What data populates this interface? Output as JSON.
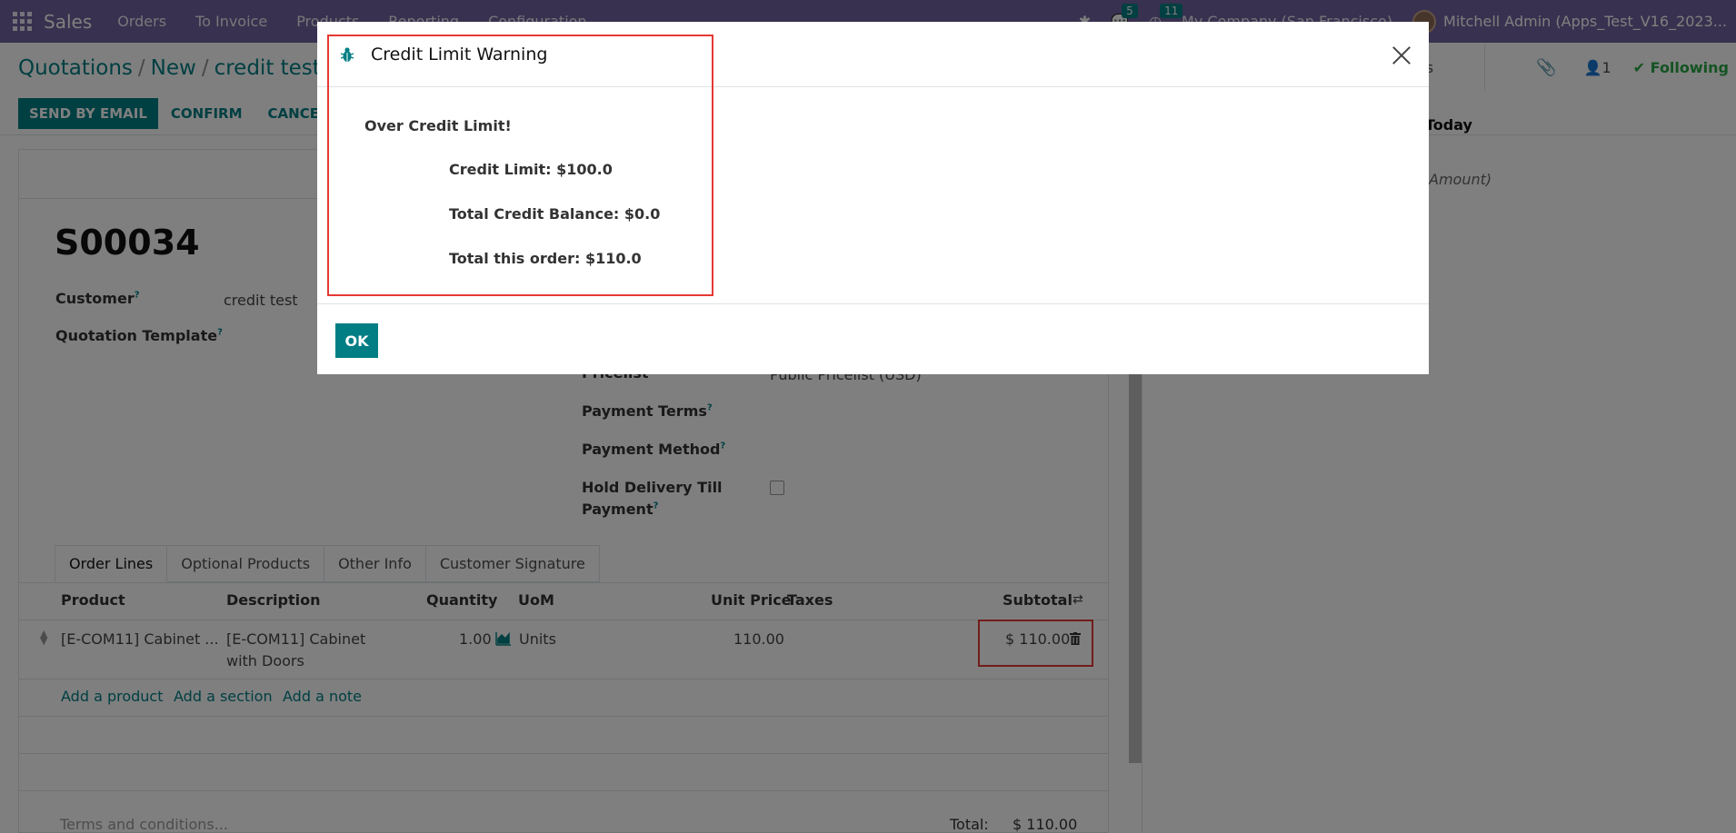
{
  "navbar": {
    "brand": "Sales",
    "menu": [
      "Orders",
      "To Invoice",
      "Products",
      "Reporting",
      "Configuration"
    ],
    "messages_count": "5",
    "activities_count": "11",
    "company": "My Company (San Francisco)",
    "user": "Mitchell Admin (Apps_Test_V16_2023..."
  },
  "breadcrumb": {
    "first": "Quotations",
    "second": "New",
    "third": "credit test",
    "sep": "/"
  },
  "actions": {
    "send_by_email": "SEND BY EMAIL",
    "confirm": "CONFIRM",
    "cancel": "CANCEL"
  },
  "chatter": {
    "activities": "tivities",
    "followers_count": "1",
    "following": "Following",
    "today": "Today",
    "amount_fragment": "Amount)"
  },
  "form": {
    "name": "S00034",
    "customer_label": "Customer",
    "customer_value": "credit test",
    "quotation_template_label": "Quotation Template",
    "pricelist_label": "Pricelist",
    "pricelist_value": "Public Pricelist (USD)",
    "payment_terms_label": "Payment Terms",
    "payment_method_label": "Payment Method",
    "hold_delivery_label_1": "Hold Delivery Till",
    "hold_delivery_label_2": "Payment",
    "tooltip_mark": "?"
  },
  "tabs": [
    "Order Lines",
    "Optional Products",
    "Other Info",
    "Customer Signature"
  ],
  "table": {
    "headers": {
      "product": "Product",
      "description": "Description",
      "quantity": "Quantity",
      "uom": "UoM",
      "unit_price": "Unit Price",
      "taxes": "Taxes",
      "subtotal": "Subtotal"
    },
    "rows": [
      {
        "product": "[E-COM11] Cabinet ...",
        "description_1": "[E-COM11] Cabinet",
        "description_2": "with Doors",
        "quantity": "1.00",
        "uom": "Units",
        "unit_price": "110.00",
        "subtotal": "$ 110.00"
      }
    ],
    "add_product": "Add a product",
    "add_section": "Add a section",
    "add_note": "Add a note"
  },
  "footer": {
    "terms_placeholder": "Terms and conditions...",
    "total_label": "Total:",
    "total_value": "$ 110.00"
  },
  "modal": {
    "title": "Credit Limit Warning",
    "over_limit": "Over Credit Limit!",
    "credit_limit": "Credit Limit: $100.0",
    "total_balance": "Total Credit Balance: $0.0",
    "total_order": "Total this order: $110.0",
    "ok": "OK"
  },
  "colors": {
    "navbar": "#71639e",
    "primary": "#017e84",
    "highlight": "#e53935"
  }
}
